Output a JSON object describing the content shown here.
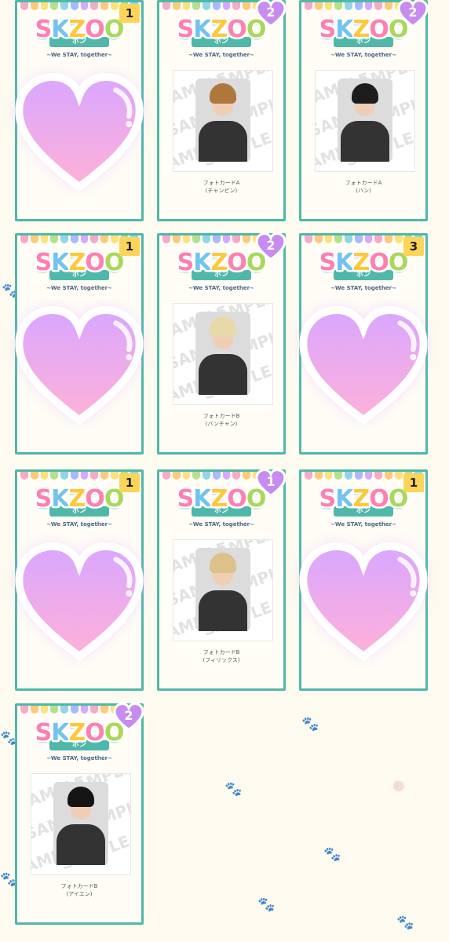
{
  "app": {
    "logo_main": [
      "S",
      "K",
      "Z",
      "O",
      "O"
    ],
    "logo_ribbon": "ポン",
    "logo_sub": "~We STAY, together~"
  },
  "colors": {
    "card_border": "#4fb8a9",
    "count_badge": "#fbd55a",
    "heart_badge": "#c68cf0",
    "big_heart_top": "#d9a6ff",
    "big_heart_bottom": "#ffb1d8",
    "background": "#fdfbef"
  },
  "cards": [
    {
      "badge_type": "count",
      "count": "1",
      "covered": true,
      "name": "",
      "caption_line1": "",
      "caption_line2": ""
    },
    {
      "badge_type": "heart",
      "count": "2",
      "covered": false,
      "caption_line1": "フォトカードA",
      "caption_line2": "(チャンビン)",
      "hair": "#b0773d"
    },
    {
      "badge_type": "heart",
      "count": "2",
      "covered": false,
      "caption_line1": "フォトカードA",
      "caption_line2": "(ハン)",
      "hair": "#1d1d1d"
    },
    {
      "badge_type": "count",
      "count": "1",
      "covered": true,
      "caption_line1": "",
      "caption_line2": ""
    },
    {
      "badge_type": "heart",
      "count": "2",
      "covered": false,
      "caption_line1": "フォトカードB",
      "caption_line2": "(バンチャン)",
      "hair": "#e8d9a8"
    },
    {
      "badge_type": "count",
      "count": "3",
      "covered": true,
      "caption_line1": "",
      "caption_line2": ""
    },
    {
      "badge_type": "count",
      "count": "1",
      "covered": true,
      "caption_line1": "",
      "caption_line2": ""
    },
    {
      "badge_type": "heart",
      "count": "1",
      "covered": false,
      "caption_line1": "フォトカードB",
      "caption_line2": "(フィリックス)",
      "hair": "#dcc28a"
    },
    {
      "badge_type": "count",
      "count": "1",
      "covered": true,
      "caption_line1": "",
      "caption_line2": ""
    },
    {
      "badge_type": "heart",
      "count": "2",
      "covered": false,
      "caption_line1": "フォトカードB",
      "caption_line2": "(アイエン)",
      "hair": "#141414"
    }
  ],
  "watermark": "SAMPLE"
}
